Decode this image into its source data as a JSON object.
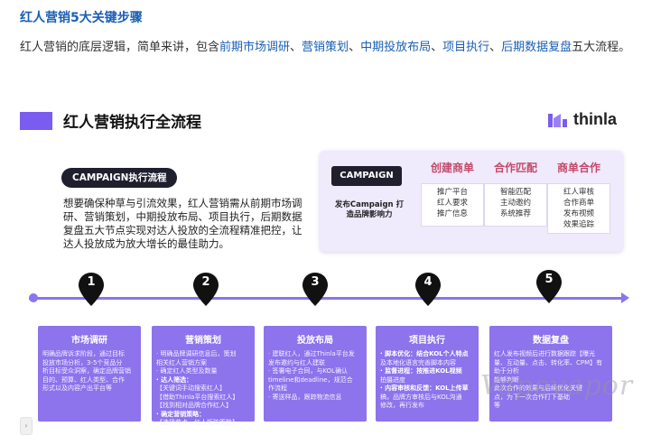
{
  "article": {
    "title": "红人营销5大关键步骤",
    "intro_prefix": "红人营销的底层逻辑，简单来讲，包含",
    "intro_links": [
      "前期市场调研",
      "营销策划",
      "中期投放布局",
      "项目执行",
      "后期数据复盘"
    ],
    "intro_sep": "、",
    "intro_suffix": "五大流程。"
  },
  "slide": {
    "title": "红人营销执行全流程",
    "logo_text": "thinla",
    "campaign_pill": "CAMPAIGN执行流程",
    "description": "想要确保种草与引流效果，红人营销需从前期市场调研、营销策划，中期投放布局、项目执行，后期数据复盘五大节点实现对达人投放的全流程精准把控，让达人投放成为放大增长的最佳助力。",
    "panel": {
      "pill": "CAMPAIGN",
      "sub": "发布Campaign 打造品牌影响力",
      "columns": [
        {
          "heading": "创建商单",
          "items": [
            "推广平台",
            "红人要求",
            "推广信息"
          ]
        },
        {
          "heading": "合作匹配",
          "items": [
            "智能匹配",
            "主动邀约",
            "系统推荐"
          ]
        },
        {
          "heading": "商单合作",
          "items": [
            "红人审核",
            "合作商单",
            "发布视频",
            "效果追踪"
          ]
        }
      ]
    },
    "steps": [
      "1",
      "2",
      "3",
      "4",
      "5"
    ],
    "cards": [
      {
        "heading": "市场调研",
        "lines": [
          "明确品牌诉求阶段，通过目标",
          "投放市场分析，3-5个竞品分",
          "析目标受众洞察，确定品牌营销",
          "目的、预算、红人类型、合作",
          "形式以及内容产出平台等"
        ]
      },
      {
        "heading": "营销策划",
        "lines": [
          "· 明确品牌调研信息后，策划",
          "  相关红人营销方案",
          "· 确定红人类型及数量",
          "· 达人筛选：",
          "  【关键词手动搜索红人】",
          "  【借助Thinla平台搜索红人】",
          "  【找到相对品牌合作红人】",
          "· 确定营销策略：",
          "  【选择节点、红人矩阵策略】"
        ]
      },
      {
        "heading": "投放布局",
        "lines": [
          "· 建联红人，通过Thinla平台发",
          "  发布邀约与红人建联",
          "· 签署电子合同，与KOL确认",
          "  timeline和deadline，规范合",
          "  作流程",
          "· 寄送样品，跟踪物流信息"
        ]
      },
      {
        "heading": "项目执行",
        "lines": [
          "· 脚本优化：结合KOL个人特点",
          "  及本地化语言完善脚本内容",
          "· 监督进程：按推进KOL视频",
          "  拍摄进度",
          "· 内容审核和反馈：KOL上传草",
          "  稿，品牌方审核后与KOL沟通",
          "  修改，再行发布"
        ]
      },
      {
        "heading": "数据复盘",
        "lines": [
          "红人发布视频后进行数据跟踪【曝光",
          "量、互动量、点击、转化率、CPM】有助于分析",
          "能够判断",
          "此次合作的效果与后续优化关键",
          "点，为下一次合作打下基础",
          "等"
        ]
      }
    ]
  },
  "watermark": "Vapevapor",
  "colors": {
    "accent": "#8b74f0",
    "card": "#8d73ec",
    "link": "#1a5fb4",
    "heading_red": "#c44a6a",
    "dark_pill": "#1f1f2e"
  }
}
